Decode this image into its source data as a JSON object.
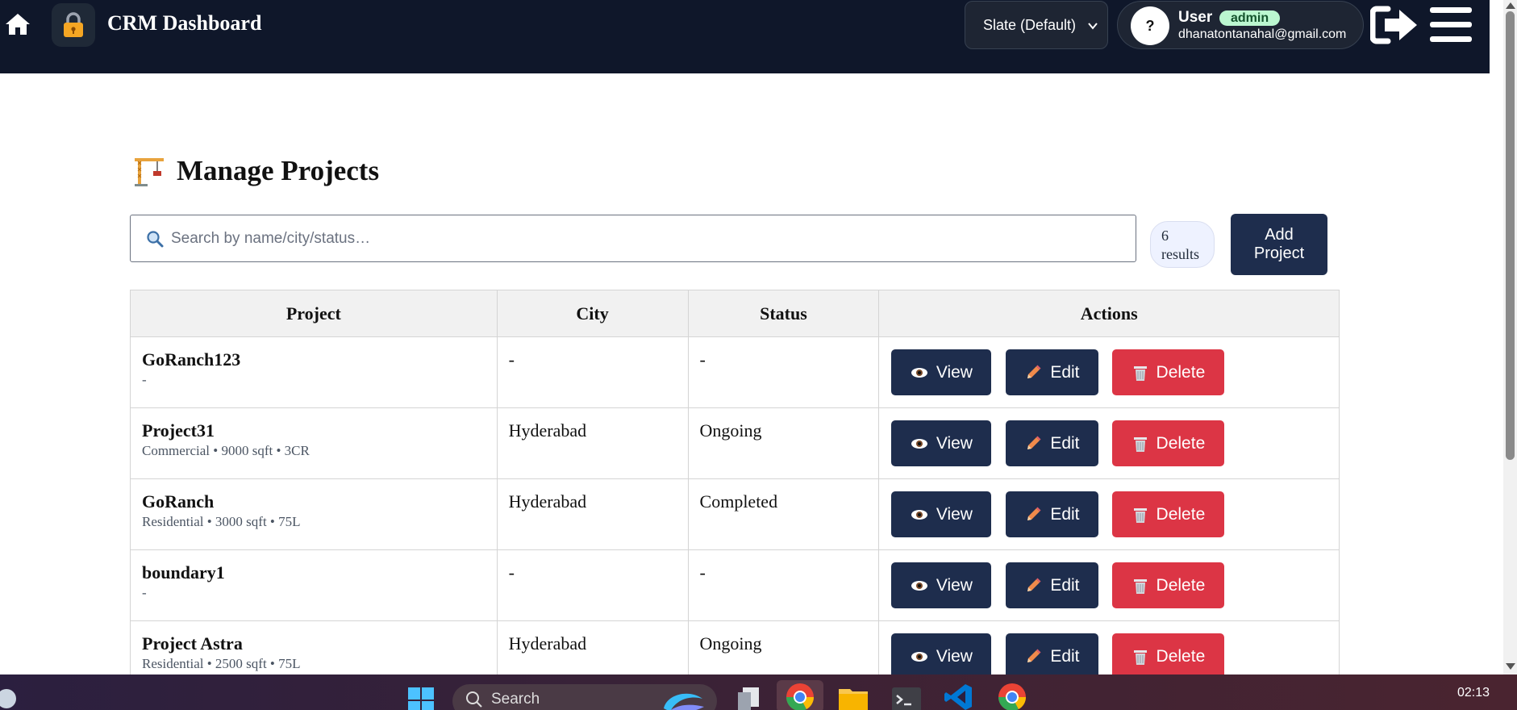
{
  "header": {
    "app_title": "CRM Dashboard",
    "theme_select_value": "Slate (Default)",
    "user_avatar": "?",
    "user_name": "User",
    "user_role": "admin",
    "user_email": "dhanatontanahal@gmail.com",
    "icons": [
      "home-icon",
      "lock-icon",
      "chevron-down-icon",
      "logout-icon",
      "menu-icon"
    ]
  },
  "page": {
    "title": "Manage Projects",
    "title_icon": "crane-icon",
    "search_placeholder": "Search by name/city/status…",
    "results_count": "6",
    "results_label": "results",
    "add_button_label": "Add Project"
  },
  "table": {
    "columns": [
      "Project",
      "City",
      "Status",
      "Actions"
    ],
    "action_labels": {
      "view": "View",
      "edit": "Edit",
      "delete": "Delete"
    },
    "rows": [
      {
        "name": "GoRanch123",
        "details": "-",
        "city": "-",
        "status": "-"
      },
      {
        "name": "Project31",
        "details": "Commercial • 9000 sqft • 3CR",
        "city": "Hyderabad",
        "status": "Ongoing"
      },
      {
        "name": "GoRanch",
        "details": "Residential • 3000 sqft • 75L",
        "city": "Hyderabad",
        "status": "Completed"
      },
      {
        "name": "boundary1",
        "details": "-",
        "city": "-",
        "status": "-"
      },
      {
        "name": "Project Astra",
        "details": "Residential • 2500 sqft • 75L",
        "city": "Hyderabad",
        "status": "Ongoing"
      }
    ]
  },
  "taskbar": {
    "search_label": "Search",
    "time": "02:13",
    "apps": [
      "windows-start-icon",
      "copilot-icon",
      "task-view-icon",
      "chrome-icon",
      "file-explorer-icon",
      "terminal-icon",
      "vscode-icon",
      "chrome-icon"
    ]
  },
  "colors": {
    "header_bg": "#0f172a",
    "primary_button": "#1e2d4d",
    "danger_button": "#dc3545",
    "role_badge_bg": "#bbf7d0"
  }
}
